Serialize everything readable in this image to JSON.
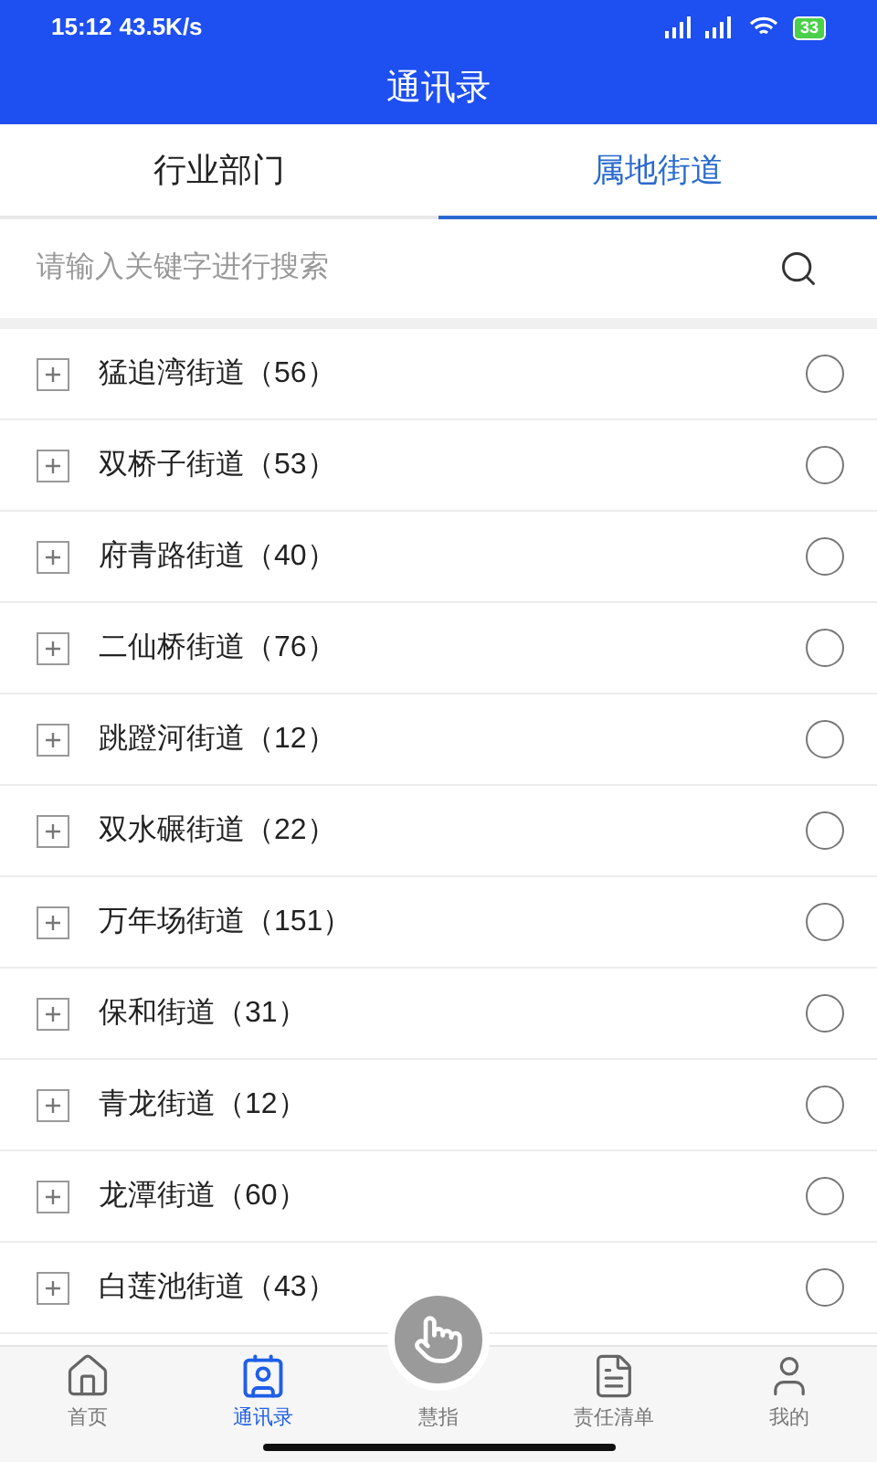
{
  "status_bar": {
    "time": "15:12",
    "speed": "43.5K/s",
    "battery": "33"
  },
  "header": {
    "title": "通讯录"
  },
  "tabs": [
    {
      "label": "行业部门",
      "selected": false
    },
    {
      "label": "属地街道",
      "selected": true
    }
  ],
  "search": {
    "placeholder": "请输入关键字进行搜索"
  },
  "streets": [
    {
      "name": "猛追湾街道（56）",
      "selected": false
    },
    {
      "name": "双桥子街道（53）",
      "selected": false
    },
    {
      "name": "府青路街道（40）",
      "selected": false
    },
    {
      "name": "二仙桥街道（76）",
      "selected": false
    },
    {
      "name": "跳蹬河街道（12）",
      "selected": false
    },
    {
      "name": "双水碾街道（22）",
      "selected": false
    },
    {
      "name": "万年场街道（151）",
      "selected": false
    },
    {
      "name": "保和街道（31）",
      "selected": false
    },
    {
      "name": "青龙街道（12）",
      "selected": false
    },
    {
      "name": "龙潭街道（60）",
      "selected": false
    },
    {
      "name": "白莲池街道（43）",
      "selected": false
    }
  ],
  "bottom_nav": [
    {
      "label": "首页",
      "kind": "home",
      "selected": false
    },
    {
      "label": "通讯录",
      "kind": "contacts",
      "selected": true
    },
    {
      "label": "慧指",
      "kind": "center",
      "selected": false
    },
    {
      "label": "责任清单",
      "kind": "list",
      "selected": false
    },
    {
      "label": "我的",
      "kind": "profile",
      "selected": false
    }
  ]
}
